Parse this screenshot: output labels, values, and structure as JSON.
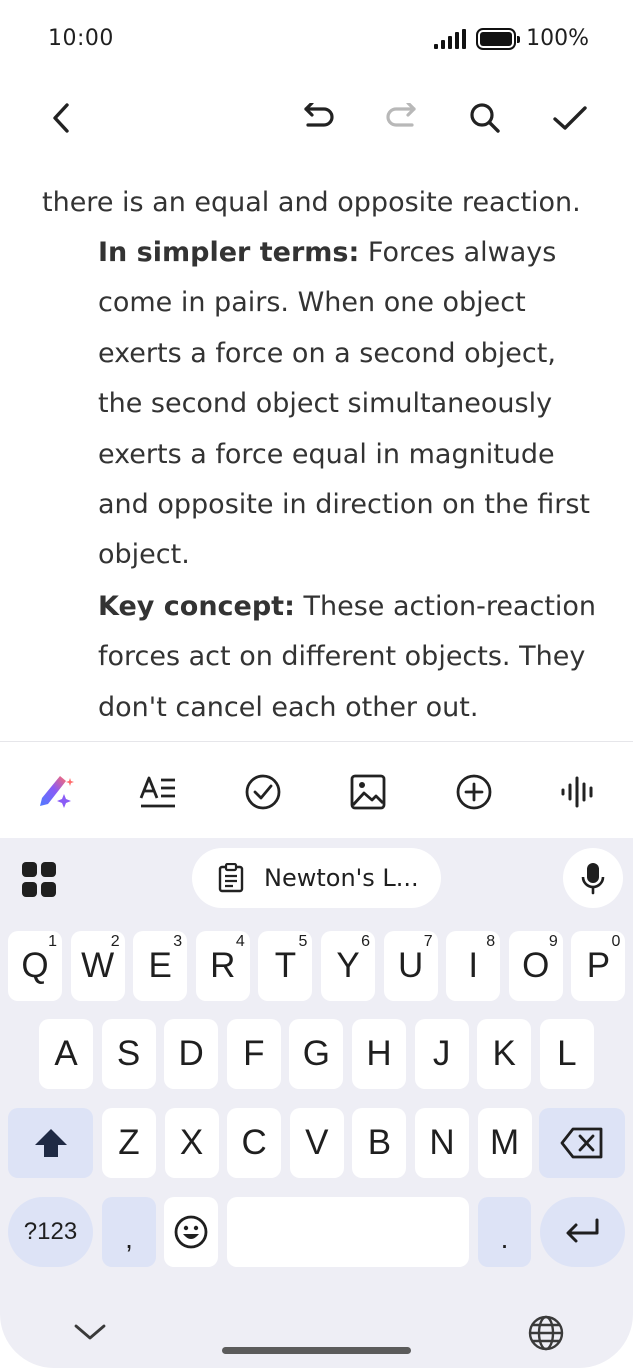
{
  "status_bar": {
    "time": "10:00",
    "battery": "100%"
  },
  "toolbar": {
    "icons": [
      "back-icon",
      "undo-icon",
      "redo-icon",
      "search-icon",
      "check-icon"
    ]
  },
  "document": {
    "lead_line": "there is an equal and opposite reaction.",
    "para1_label": "In simpler terms:",
    "para1_text": "Forces always come in pairs. When one object exerts a force on a second object, the second object simultaneously exerts a force equal in magnitude and opposite in direction on the first object.",
    "para2_label": "Key concept:",
    "para2_text": "These action-reaction forces act on different objects. They don't cancel each other out."
  },
  "format_bar": {
    "icons": [
      "ai-pen-icon",
      "text-format-icon",
      "checkbox-icon",
      "image-icon",
      "add-icon",
      "voice-wave-icon"
    ]
  },
  "keyboard": {
    "clipboard_chip": "Newton's L...",
    "row1": [
      {
        "k": "Q",
        "h": "1"
      },
      {
        "k": "W",
        "h": "2"
      },
      {
        "k": "E",
        "h": "3"
      },
      {
        "k": "R",
        "h": "4"
      },
      {
        "k": "T",
        "h": "5"
      },
      {
        "k": "Y",
        "h": "6"
      },
      {
        "k": "U",
        "h": "7"
      },
      {
        "k": "I",
        "h": "8"
      },
      {
        "k": "O",
        "h": "9"
      },
      {
        "k": "P",
        "h": "0"
      }
    ],
    "row2": [
      "A",
      "S",
      "D",
      "F",
      "G",
      "H",
      "J",
      "K",
      "L"
    ],
    "row3": [
      "Z",
      "X",
      "C",
      "V",
      "B",
      "N",
      "M"
    ],
    "symbols_key": "?123",
    "comma_key": ",",
    "period_key": "."
  },
  "colors": {
    "keyboard_bg": "#eeeef5",
    "function_key": "#dde3f6",
    "text": "#333333"
  }
}
